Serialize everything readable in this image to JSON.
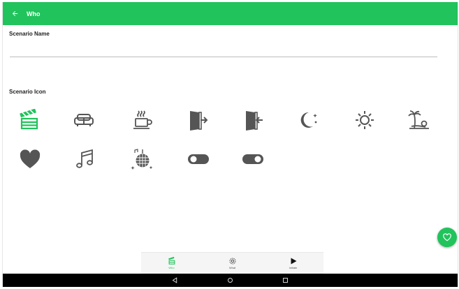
{
  "app_bar": {
    "title": "Who",
    "color": "#21c35c"
  },
  "form": {
    "scenario_name_label": "Scenario Name",
    "scenario_name_value": "",
    "scenario_icon_label": "Scenario Icon"
  },
  "icons": [
    {
      "name": "clapperboard-icon",
      "selected": true
    },
    {
      "name": "sofa-icon",
      "selected": false
    },
    {
      "name": "coffee-cup-icon",
      "selected": false
    },
    {
      "name": "door-exit-icon",
      "selected": false
    },
    {
      "name": "door-enter-icon",
      "selected": false
    },
    {
      "name": "moon-stars-icon",
      "selected": false
    },
    {
      "name": "sun-icon",
      "selected": false
    },
    {
      "name": "palm-beach-icon",
      "selected": false
    },
    {
      "name": "heart-icon",
      "selected": false
    },
    {
      "name": "music-note-icon",
      "selected": false
    },
    {
      "name": "disco-ball-icon",
      "selected": false
    },
    {
      "name": "toggle-off-icon",
      "selected": false
    },
    {
      "name": "toggle-on-icon",
      "selected": false
    }
  ],
  "colors": {
    "accent": "#21c35c",
    "icon_gray": "#555555"
  },
  "fab": {
    "icon": "heart-outline-icon"
  },
  "bottom_nav": {
    "items": [
      {
        "label": "Who",
        "icon": "clapperboard-icon",
        "active": true
      },
      {
        "label": "What",
        "icon": "gear-icon",
        "active": false
      },
      {
        "label": "Initiate",
        "icon": "play-icon",
        "active": false
      }
    ]
  },
  "system_nav": [
    "back-icon",
    "home-icon",
    "recents-icon"
  ]
}
